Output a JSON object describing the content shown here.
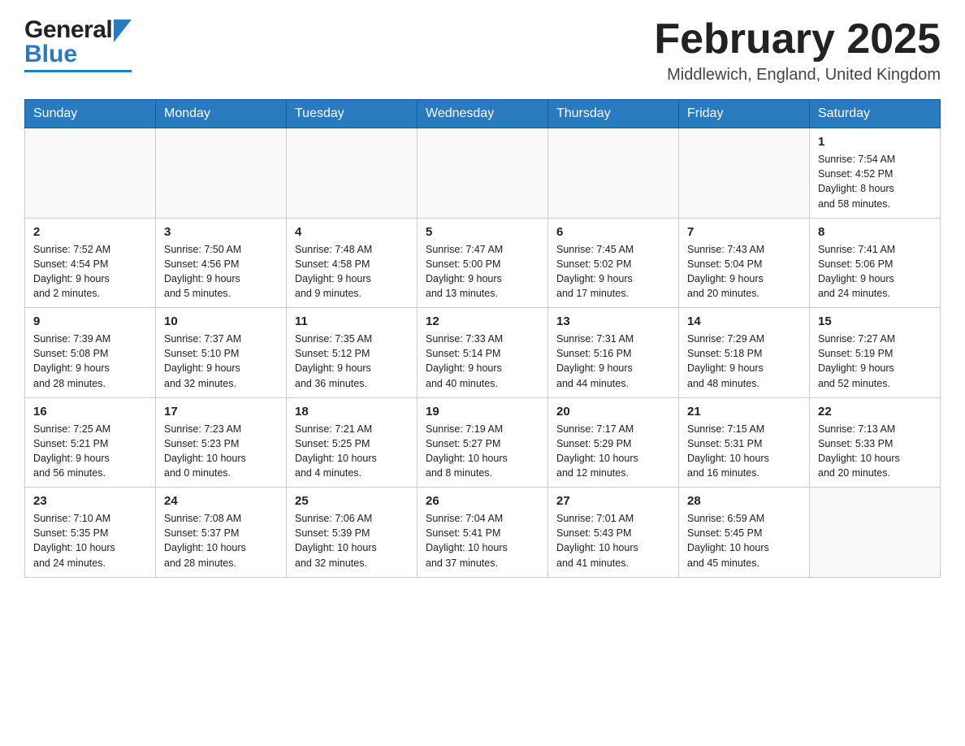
{
  "header": {
    "logo_general": "General",
    "logo_blue": "Blue",
    "title": "February 2025",
    "location": "Middlewich, England, United Kingdom"
  },
  "weekdays": [
    "Sunday",
    "Monday",
    "Tuesday",
    "Wednesday",
    "Thursday",
    "Friday",
    "Saturday"
  ],
  "weeks": [
    [
      {
        "num": "",
        "info": ""
      },
      {
        "num": "",
        "info": ""
      },
      {
        "num": "",
        "info": ""
      },
      {
        "num": "",
        "info": ""
      },
      {
        "num": "",
        "info": ""
      },
      {
        "num": "",
        "info": ""
      },
      {
        "num": "1",
        "info": "Sunrise: 7:54 AM\nSunset: 4:52 PM\nDaylight: 8 hours\nand 58 minutes."
      }
    ],
    [
      {
        "num": "2",
        "info": "Sunrise: 7:52 AM\nSunset: 4:54 PM\nDaylight: 9 hours\nand 2 minutes."
      },
      {
        "num": "3",
        "info": "Sunrise: 7:50 AM\nSunset: 4:56 PM\nDaylight: 9 hours\nand 5 minutes."
      },
      {
        "num": "4",
        "info": "Sunrise: 7:48 AM\nSunset: 4:58 PM\nDaylight: 9 hours\nand 9 minutes."
      },
      {
        "num": "5",
        "info": "Sunrise: 7:47 AM\nSunset: 5:00 PM\nDaylight: 9 hours\nand 13 minutes."
      },
      {
        "num": "6",
        "info": "Sunrise: 7:45 AM\nSunset: 5:02 PM\nDaylight: 9 hours\nand 17 minutes."
      },
      {
        "num": "7",
        "info": "Sunrise: 7:43 AM\nSunset: 5:04 PM\nDaylight: 9 hours\nand 20 minutes."
      },
      {
        "num": "8",
        "info": "Sunrise: 7:41 AM\nSunset: 5:06 PM\nDaylight: 9 hours\nand 24 minutes."
      }
    ],
    [
      {
        "num": "9",
        "info": "Sunrise: 7:39 AM\nSunset: 5:08 PM\nDaylight: 9 hours\nand 28 minutes."
      },
      {
        "num": "10",
        "info": "Sunrise: 7:37 AM\nSunset: 5:10 PM\nDaylight: 9 hours\nand 32 minutes."
      },
      {
        "num": "11",
        "info": "Sunrise: 7:35 AM\nSunset: 5:12 PM\nDaylight: 9 hours\nand 36 minutes."
      },
      {
        "num": "12",
        "info": "Sunrise: 7:33 AM\nSunset: 5:14 PM\nDaylight: 9 hours\nand 40 minutes."
      },
      {
        "num": "13",
        "info": "Sunrise: 7:31 AM\nSunset: 5:16 PM\nDaylight: 9 hours\nand 44 minutes."
      },
      {
        "num": "14",
        "info": "Sunrise: 7:29 AM\nSunset: 5:18 PM\nDaylight: 9 hours\nand 48 minutes."
      },
      {
        "num": "15",
        "info": "Sunrise: 7:27 AM\nSunset: 5:19 PM\nDaylight: 9 hours\nand 52 minutes."
      }
    ],
    [
      {
        "num": "16",
        "info": "Sunrise: 7:25 AM\nSunset: 5:21 PM\nDaylight: 9 hours\nand 56 minutes."
      },
      {
        "num": "17",
        "info": "Sunrise: 7:23 AM\nSunset: 5:23 PM\nDaylight: 10 hours\nand 0 minutes."
      },
      {
        "num": "18",
        "info": "Sunrise: 7:21 AM\nSunset: 5:25 PM\nDaylight: 10 hours\nand 4 minutes."
      },
      {
        "num": "19",
        "info": "Sunrise: 7:19 AM\nSunset: 5:27 PM\nDaylight: 10 hours\nand 8 minutes."
      },
      {
        "num": "20",
        "info": "Sunrise: 7:17 AM\nSunset: 5:29 PM\nDaylight: 10 hours\nand 12 minutes."
      },
      {
        "num": "21",
        "info": "Sunrise: 7:15 AM\nSunset: 5:31 PM\nDaylight: 10 hours\nand 16 minutes."
      },
      {
        "num": "22",
        "info": "Sunrise: 7:13 AM\nSunset: 5:33 PM\nDaylight: 10 hours\nand 20 minutes."
      }
    ],
    [
      {
        "num": "23",
        "info": "Sunrise: 7:10 AM\nSunset: 5:35 PM\nDaylight: 10 hours\nand 24 minutes."
      },
      {
        "num": "24",
        "info": "Sunrise: 7:08 AM\nSunset: 5:37 PM\nDaylight: 10 hours\nand 28 minutes."
      },
      {
        "num": "25",
        "info": "Sunrise: 7:06 AM\nSunset: 5:39 PM\nDaylight: 10 hours\nand 32 minutes."
      },
      {
        "num": "26",
        "info": "Sunrise: 7:04 AM\nSunset: 5:41 PM\nDaylight: 10 hours\nand 37 minutes."
      },
      {
        "num": "27",
        "info": "Sunrise: 7:01 AM\nSunset: 5:43 PM\nDaylight: 10 hours\nand 41 minutes."
      },
      {
        "num": "28",
        "info": "Sunrise: 6:59 AM\nSunset: 5:45 PM\nDaylight: 10 hours\nand 45 minutes."
      },
      {
        "num": "",
        "info": ""
      }
    ]
  ]
}
